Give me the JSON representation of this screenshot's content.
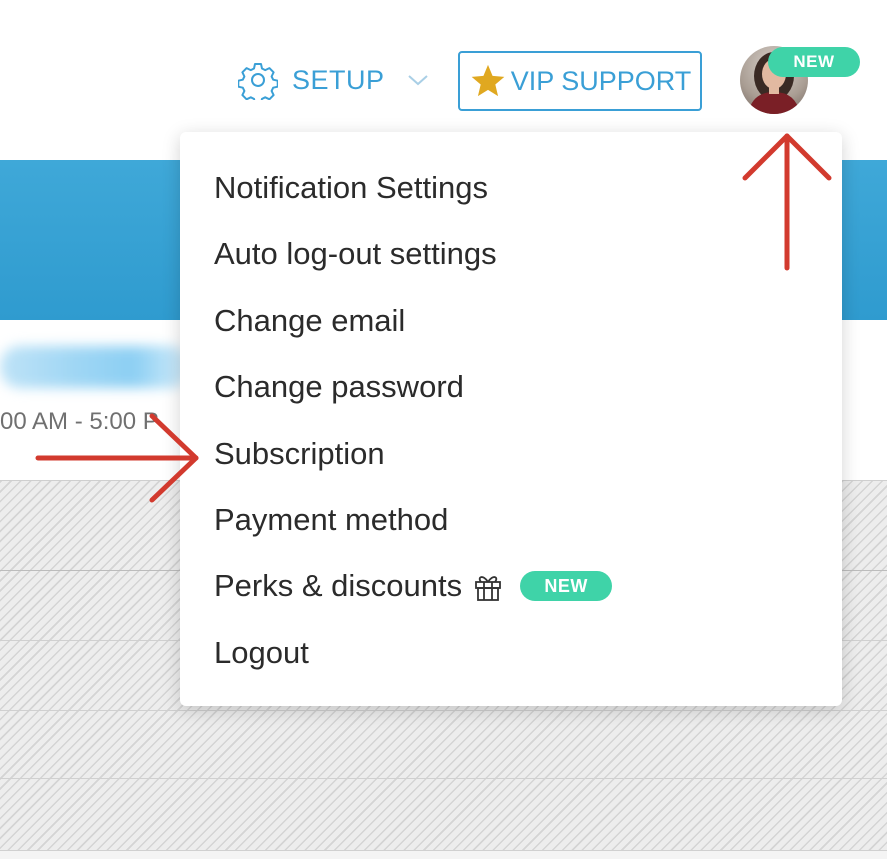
{
  "header": {
    "setup_label": "SETUP",
    "vip_label": "VIP SUPPORT",
    "avatar_badge": "NEW",
    "accent_color": "#3a9fd6",
    "star_color": "#e0a820",
    "badge_color": "#3fd3a8"
  },
  "background": {
    "hours_text": "00 AM - 5:00 P"
  },
  "menu": {
    "items": [
      {
        "label": "Notification Settings"
      },
      {
        "label": "Auto log-out settings"
      },
      {
        "label": "Change email"
      },
      {
        "label": "Change password"
      },
      {
        "label": "Subscription"
      },
      {
        "label": "Payment method"
      },
      {
        "label": "Perks & discounts",
        "icon": "gift-icon",
        "badge": "NEW"
      },
      {
        "label": "Logout"
      }
    ]
  },
  "annotations": {
    "arrow_color": "#d23a2e"
  }
}
